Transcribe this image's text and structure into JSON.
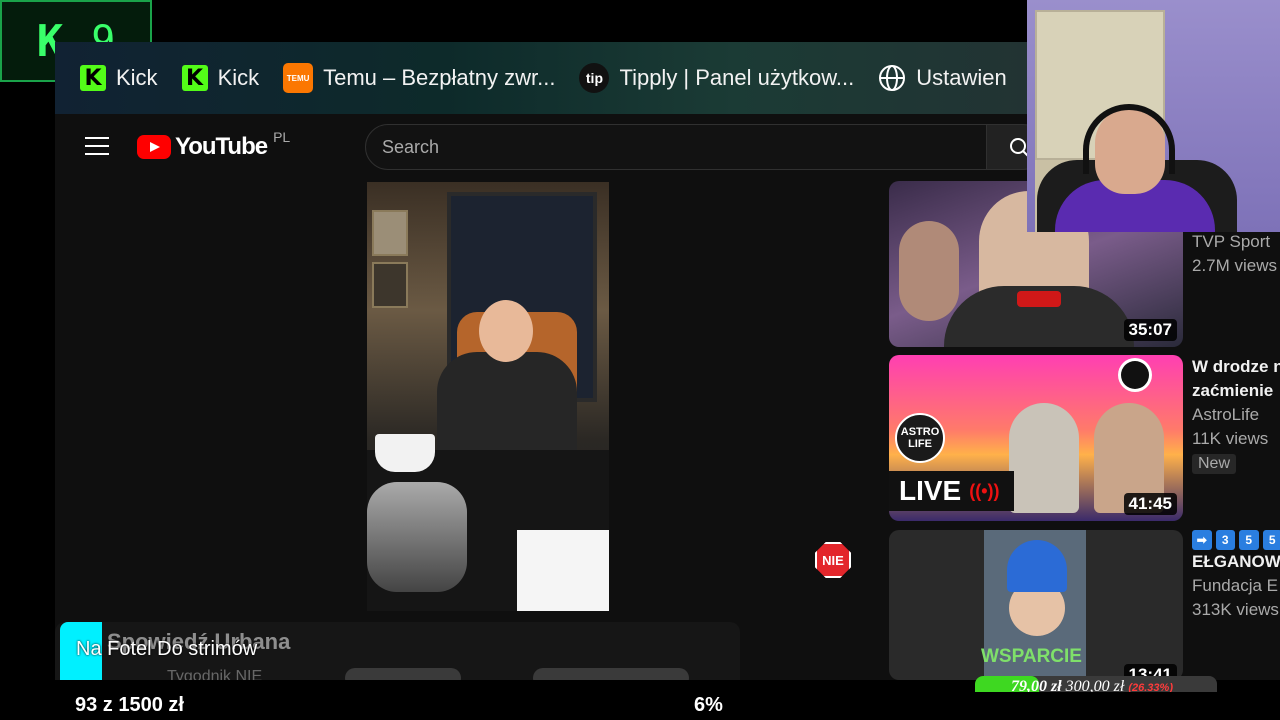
{
  "overlay_logo": {
    "letter": "K",
    "number": "9"
  },
  "bookmarks": [
    {
      "label": "Kick",
      "icon": "kick-icon"
    },
    {
      "label": "Kick",
      "icon": "kick-icon"
    },
    {
      "label": "Temu – Bezpłatny zwr...",
      "icon": "temu-icon",
      "icon_text": "TEMU"
    },
    {
      "label": "Tipply | Panel użytkow...",
      "icon": "tipply-icon",
      "icon_text": "tip"
    },
    {
      "label": "Ustawien",
      "icon": "globe-icon"
    }
  ],
  "youtube": {
    "logo": "YouTube",
    "country": "PL",
    "search_placeholder": "Search",
    "video_title": "Spowiedź Urbana",
    "channel": "Tygodnik NIE",
    "badge": "NIE"
  },
  "recommendations": [
    {
      "title": "",
      "channel": "TVP Sport",
      "views": "2.7M views",
      "duration": "35:07"
    },
    {
      "title": "W drodze n",
      "title2": "zaćmienie",
      "channel": "AstroLife",
      "views": "11K views",
      "badge": "New",
      "duration": "41:45",
      "live_text": "LIVE",
      "logo_text": "ASTRO LIFE"
    },
    {
      "emoji_row": [
        "➡",
        "3",
        "5",
        "5"
      ],
      "title": "EŁGANOW",
      "channel": "Fundacja E",
      "views": "313K views",
      "duration": "13:41",
      "overlay_text": "WSPARCIE"
    }
  ],
  "stream_overlay": {
    "title": "Na Fotel Do strimów",
    "donation_progress": "93  z  1500  zł",
    "percent": "6%",
    "goal_current": "79,00 zł",
    "goal_target": "300,00 zł",
    "goal_percent": "(26.33%)",
    "goal_fraction": 0.2633
  },
  "colors": {
    "kick_green": "#53fc18",
    "youtube_red": "#ff0000",
    "goal_green": "#3ed821"
  }
}
